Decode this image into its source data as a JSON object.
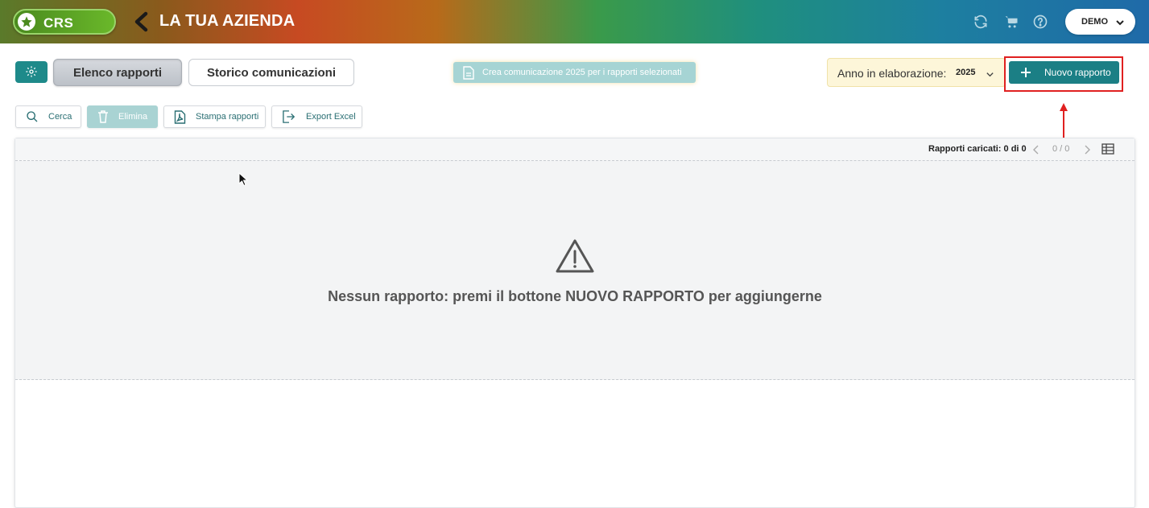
{
  "header": {
    "logo_text": "CRS",
    "title": "LA TUA AZIENDA",
    "user_menu_label": "DEMO",
    "icons": [
      "refresh-icon",
      "cart-icon",
      "help-icon"
    ]
  },
  "tabs": [
    {
      "label": "Elenco rapporti",
      "active": true
    },
    {
      "label": "Storico comunicazioni",
      "active": false
    }
  ],
  "crea_label": "Crea comunicazione 2025 per i rapporti selezionati",
  "anno": {
    "label": "Anno in elaborazione:",
    "value": "2025"
  },
  "nuovo_label": "Nuovo rapporto",
  "actions": {
    "cerca": "Cerca",
    "elimina": "Elimina",
    "stampa": "Stampa rapporti",
    "export": "Export Excel"
  },
  "table": {
    "loaded_label": "Rapporti caricati: 0 di 0",
    "page_count": "0 / 0",
    "empty_message": "Nessun rapporto: premi il bottone NUOVO RAPPORTO per aggiungerne"
  },
  "colors": {
    "accent": "#1b7f85",
    "highlight": "#e02020"
  }
}
